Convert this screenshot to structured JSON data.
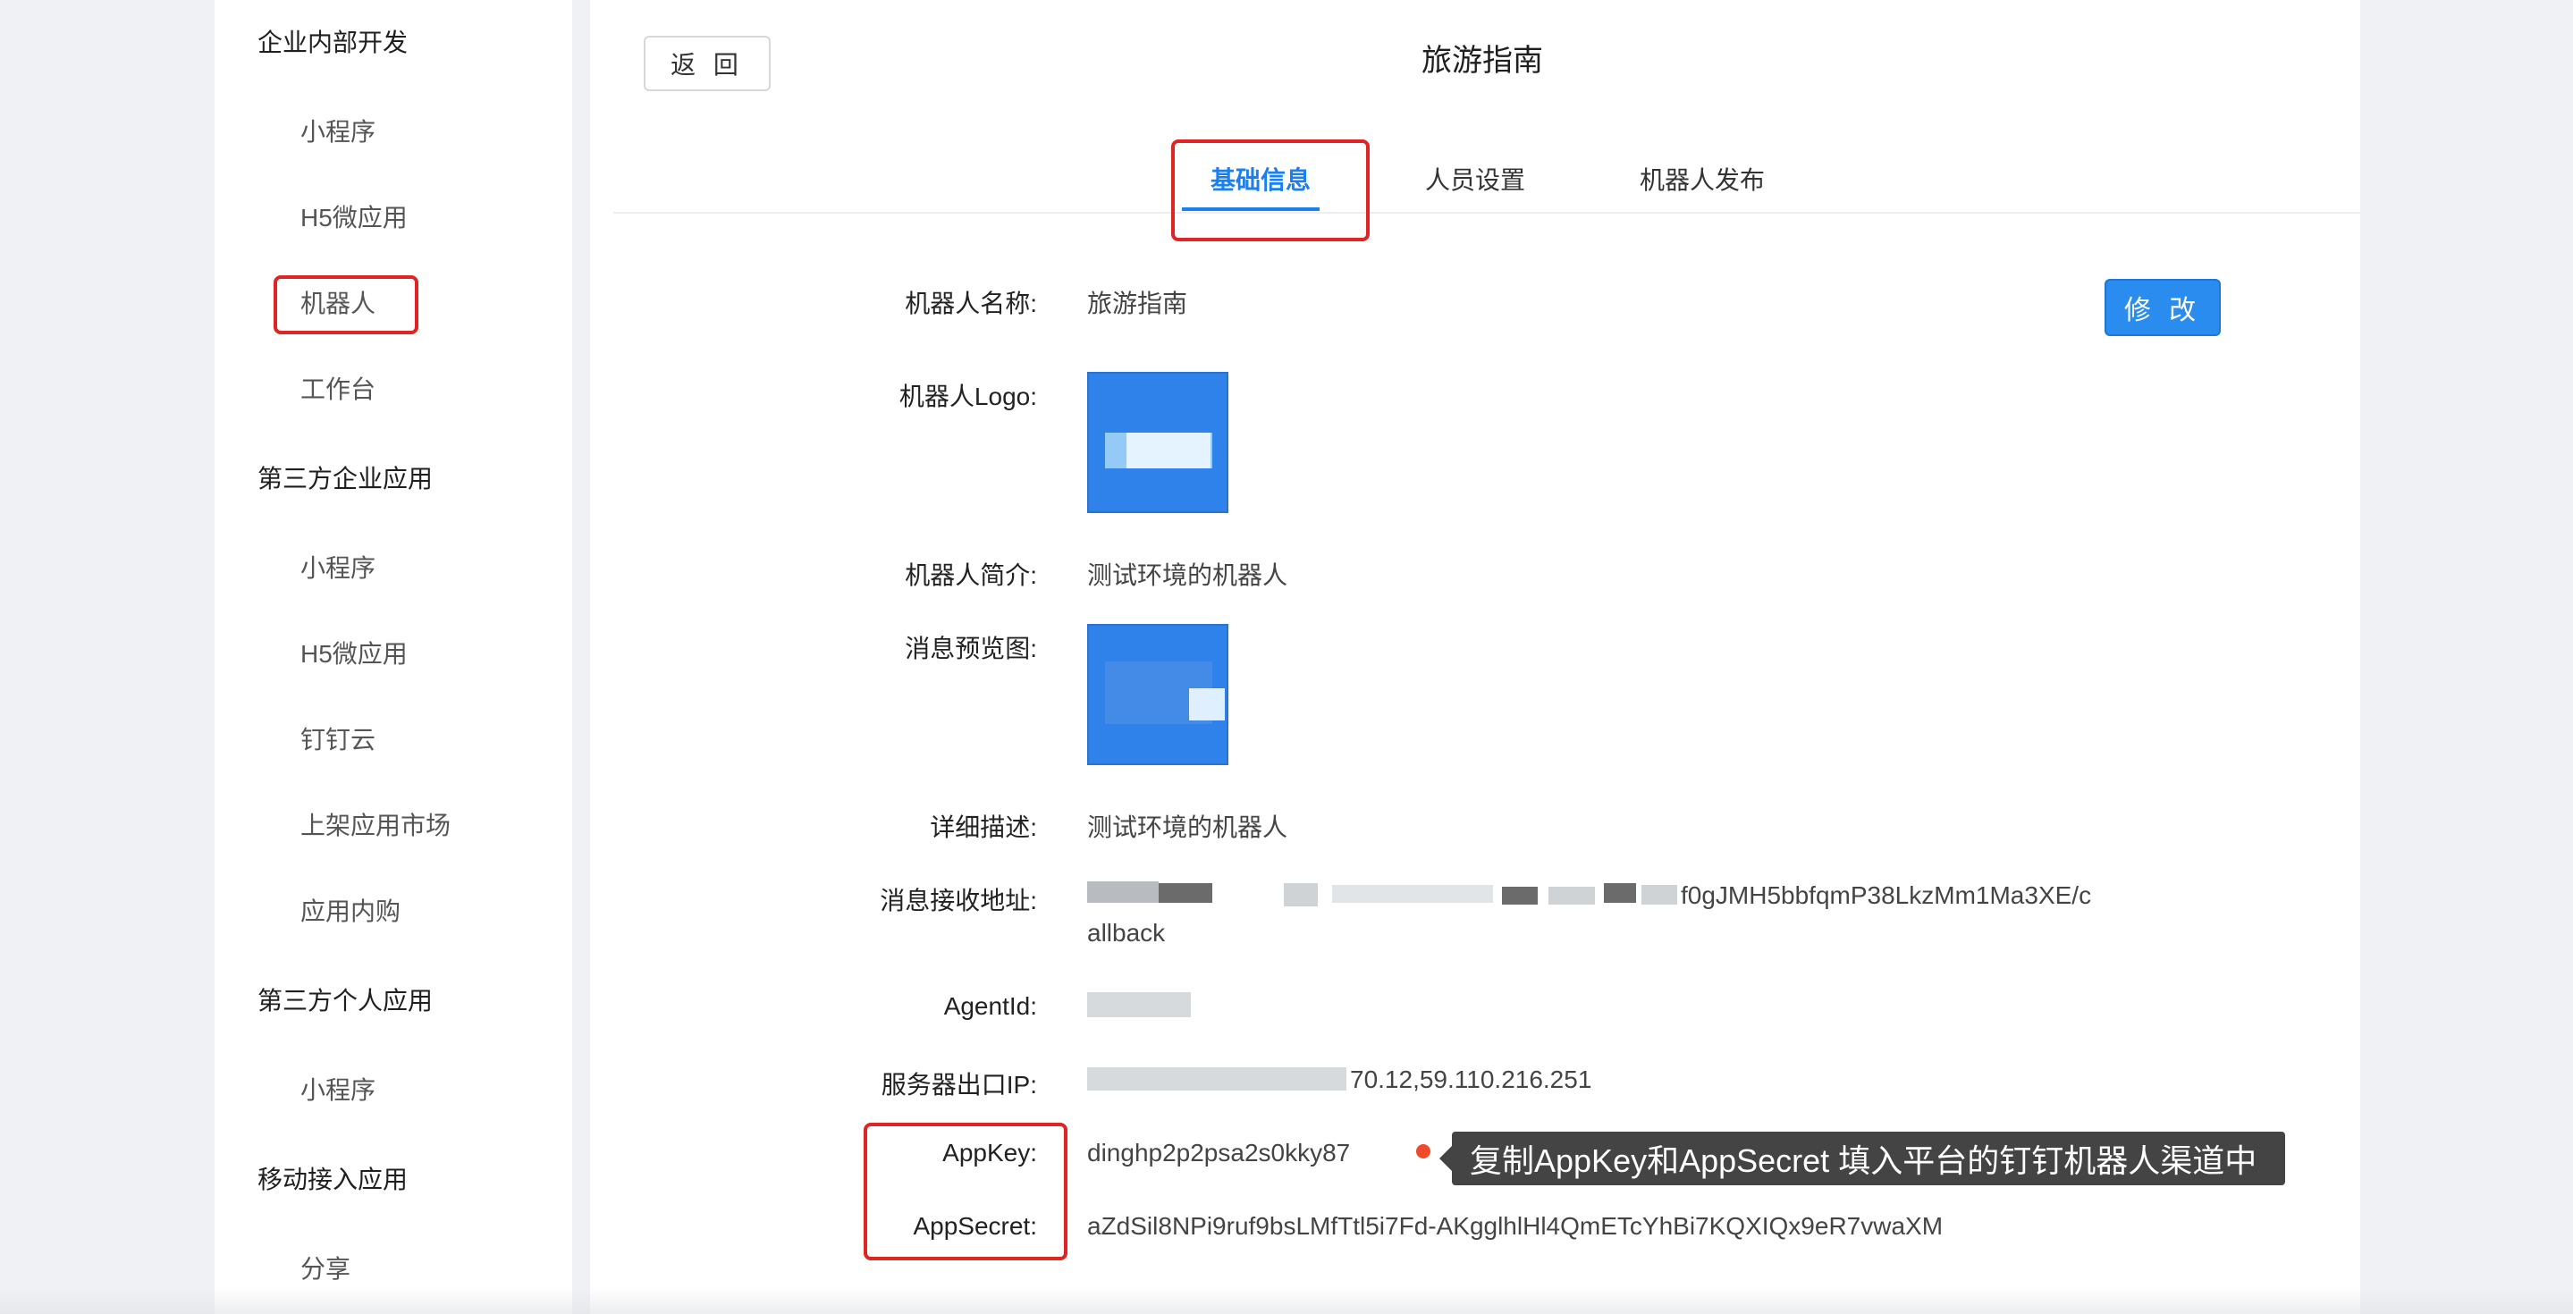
{
  "sidebar": {
    "groups": [
      {
        "title": "企业内部开发",
        "items": [
          "小程序",
          "H5微应用",
          "机器人",
          "工作台"
        ]
      },
      {
        "title": "第三方企业应用",
        "items": [
          "小程序",
          "H5微应用",
          "钉钉云",
          "上架应用市场",
          "应用内购"
        ]
      },
      {
        "title": "第三方个人应用",
        "items": [
          "小程序"
        ]
      },
      {
        "title": "移动接入应用",
        "items": [
          "分享"
        ]
      }
    ]
  },
  "header": {
    "back_label": "返 回",
    "title": "旅游指南"
  },
  "tabs": [
    {
      "label": "基础信息",
      "active": true
    },
    {
      "label": "人员设置",
      "active": false
    },
    {
      "label": "机器人发布",
      "active": false
    }
  ],
  "edit_label": "修 改",
  "fields": {
    "name": {
      "label": "机器人名称:",
      "value": "旅游指南"
    },
    "logo": {
      "label": "机器人Logo:"
    },
    "intro": {
      "label": "机器人简介:",
      "value": "测试环境的机器人"
    },
    "preview": {
      "label": "消息预览图:"
    },
    "description": {
      "label": "详细描述:",
      "value": "测试环境的机器人"
    },
    "callback": {
      "label": "消息接收地址:",
      "value_line1": "f0gJMH5bbfqmP38LkzMm1Ma3XE/c",
      "value_line2": "allback"
    },
    "agentid": {
      "label": "AgentId:"
    },
    "server_ip": {
      "label": "服务器出口IP:",
      "value": "70.12,59.110.216.251"
    },
    "appkey": {
      "label": "AppKey:",
      "value": "dinghp2p2psa2s0kky87"
    },
    "appsecret": {
      "label": "AppSecret:",
      "value": "aZdSil8NPi9ruf9bsLMfTtl5i7Fd-AKgglhlHl4QmETcYhBi7KQXIQx9eR7vwaXM"
    }
  },
  "annotation": {
    "tooltip": "复制AppKey和AppSecret 填入平台的钉钉机器人渠道中"
  },
  "colors": {
    "accent": "#1a7ff0",
    "highlight": "#e02424",
    "logo_bg": "#2f82ea",
    "tooltip_bg": "#444444"
  }
}
